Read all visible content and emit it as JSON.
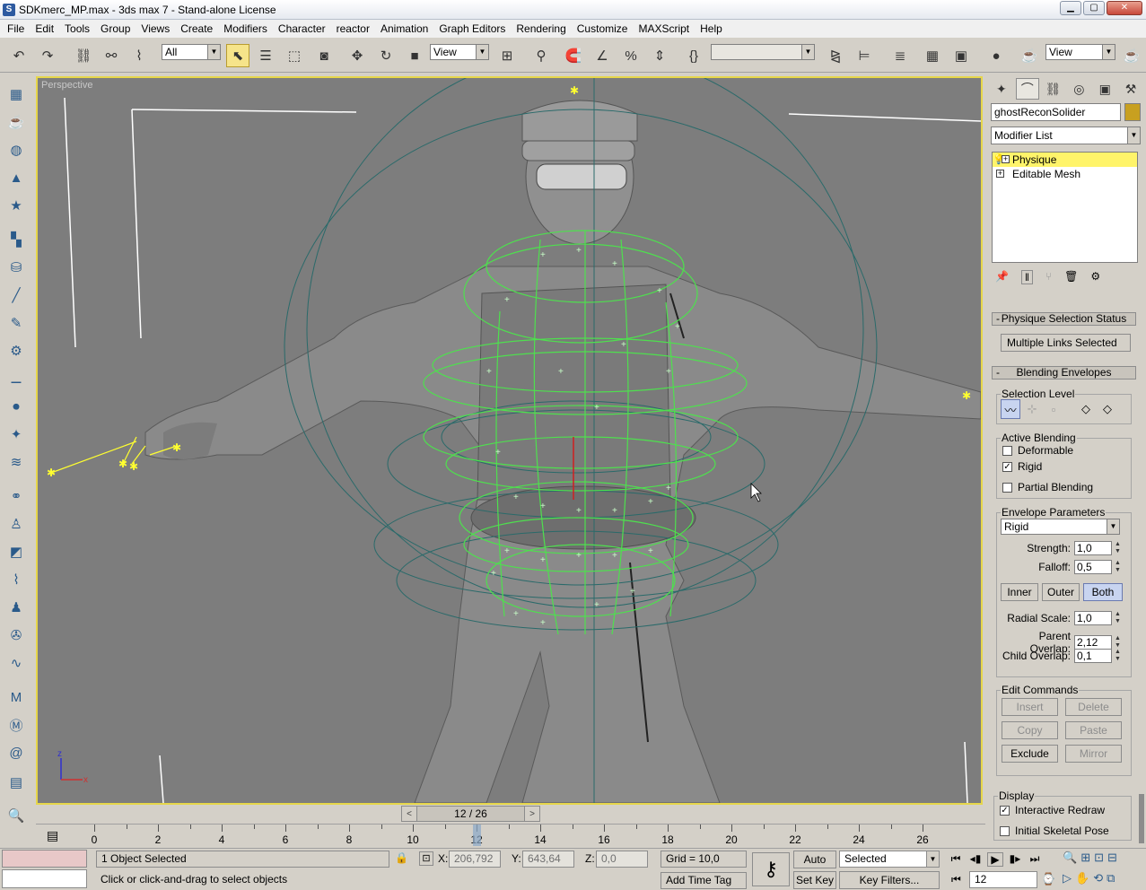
{
  "window": {
    "title": "SDKmerc_MP.max - 3ds max 7  - Stand-alone License",
    "minimize": "▁",
    "maximize": "▢",
    "close": "✕"
  },
  "menu": [
    "File",
    "Edit",
    "Tools",
    "Group",
    "Views",
    "Create",
    "Modifiers",
    "Character",
    "reactor",
    "Animation",
    "Graph Editors",
    "Rendering",
    "Customize",
    "MAXScript",
    "Help"
  ],
  "toolbar": {
    "selection_filter": "All",
    "ref_coord": "View",
    "named_selection": "",
    "render_view": "View"
  },
  "viewport": {
    "label": "Perspective",
    "axis_z": "z",
    "axis_x": "x"
  },
  "time_slider": {
    "value": "12 / 26",
    "left": "<",
    "right": ">"
  },
  "track": {
    "ticks": [
      "0",
      "2",
      "4",
      "6",
      "8",
      "10",
      "12",
      "14",
      "16",
      "18",
      "20",
      "22",
      "24",
      "26"
    ],
    "current": 12
  },
  "status": {
    "selection": "1 Object Selected",
    "prompt": "Click or click-and-drag to select objects",
    "x_label": "X:",
    "x_value": "206,792",
    "y_label": "Y:",
    "y_value": "643,64",
    "z_label": "Z:",
    "z_value": "0,0",
    "grid": "Grid = 10,0",
    "add_time_tag": "Add Time Tag",
    "auto_key": "Auto Key",
    "set_key": "Set Key",
    "key_mode": "Selected",
    "key_filters": "Key Filters...",
    "frame": "12"
  },
  "command_panel": {
    "object_name": "ghostReconSolider",
    "object_color": "#c8a020",
    "modifier_list": "Modifier List",
    "stack": [
      {
        "label": "Physique",
        "selected": true
      },
      {
        "label": "Editable Mesh",
        "selected": false
      }
    ],
    "physique_status_title": "Physique Selection Status",
    "physique_status": "Multiple Links Selected",
    "blending_title": "Blending Envelopes",
    "selection_level": "Selection Level",
    "active_blending": "Active Blending",
    "deformable": "Deformable",
    "rigid": "Rigid",
    "partial_blending": "Partial Blending",
    "envelope_params": "Envelope Parameters",
    "envelope_type": "Rigid",
    "strength_label": "Strength:",
    "strength": "1,0",
    "falloff_label": "Falloff:",
    "falloff": "0,5",
    "inner": "Inner",
    "outer": "Outer",
    "both": "Both",
    "radial_label": "Radial Scale:",
    "radial": "1,0",
    "parent_label": "Parent Overlap:",
    "parent": "2,12",
    "child_label": "Child Overlap:",
    "child": "0,1",
    "edit_commands": "Edit Commands",
    "insert": "Insert",
    "delete": "Delete",
    "copy": "Copy",
    "paste": "Paste",
    "exclude": "Exclude",
    "mirror": "Mirror",
    "display": "Display",
    "interactive_redraw": "Interactive Redraw",
    "initial_pose": "Initial Skeletal Pose"
  }
}
